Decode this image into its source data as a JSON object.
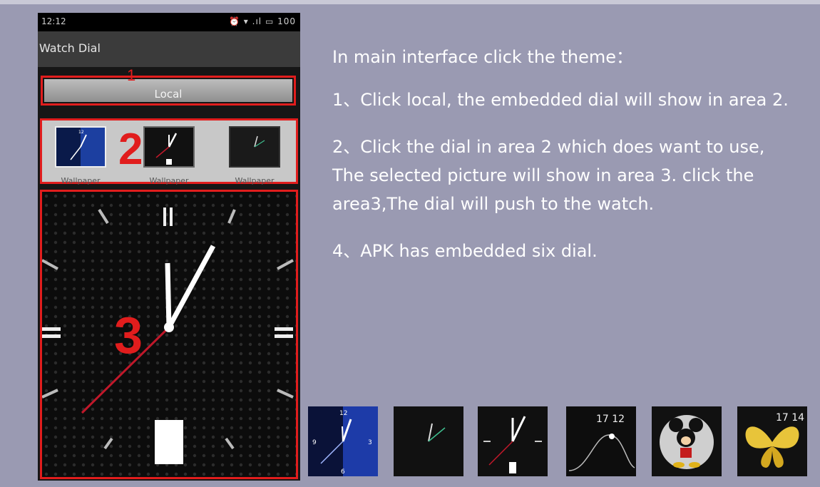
{
  "status_bar": {
    "time": "12:12",
    "right": "⏰ ▾ .ıl ▭ 100"
  },
  "app_bar": {
    "title": "Watch Dial"
  },
  "local_button": {
    "label": "Local"
  },
  "markers": {
    "one": "1",
    "two": "2",
    "three": "3"
  },
  "dial_list": [
    {
      "caption": "Wallpaper"
    },
    {
      "caption": "Wallpaper"
    },
    {
      "caption": "Wallpaper"
    }
  ],
  "instructions": {
    "intro": "In main interface click the theme：",
    "step1": "1、Click local, the embedded dial will show in area 2.",
    "step2": "2、Click the dial in area 2 which does want to use, The selected picture will show in area 3.  click the area3,The dial will push to the watch.",
    "step4": "4、APK has embedded six dial."
  },
  "embedded_dials": [
    {
      "name": "blue-analog"
    },
    {
      "name": "minimal-green"
    },
    {
      "name": "black-analog"
    },
    {
      "name": "digital-wave",
      "time": "17 12"
    },
    {
      "name": "mickey"
    },
    {
      "name": "butterfly",
      "time": "17 14"
    }
  ],
  "colors": {
    "background": "#9a9ab2",
    "highlight": "#e11d1d",
    "clock_hand": "#ffffff",
    "second_hand": "#c0182a"
  }
}
